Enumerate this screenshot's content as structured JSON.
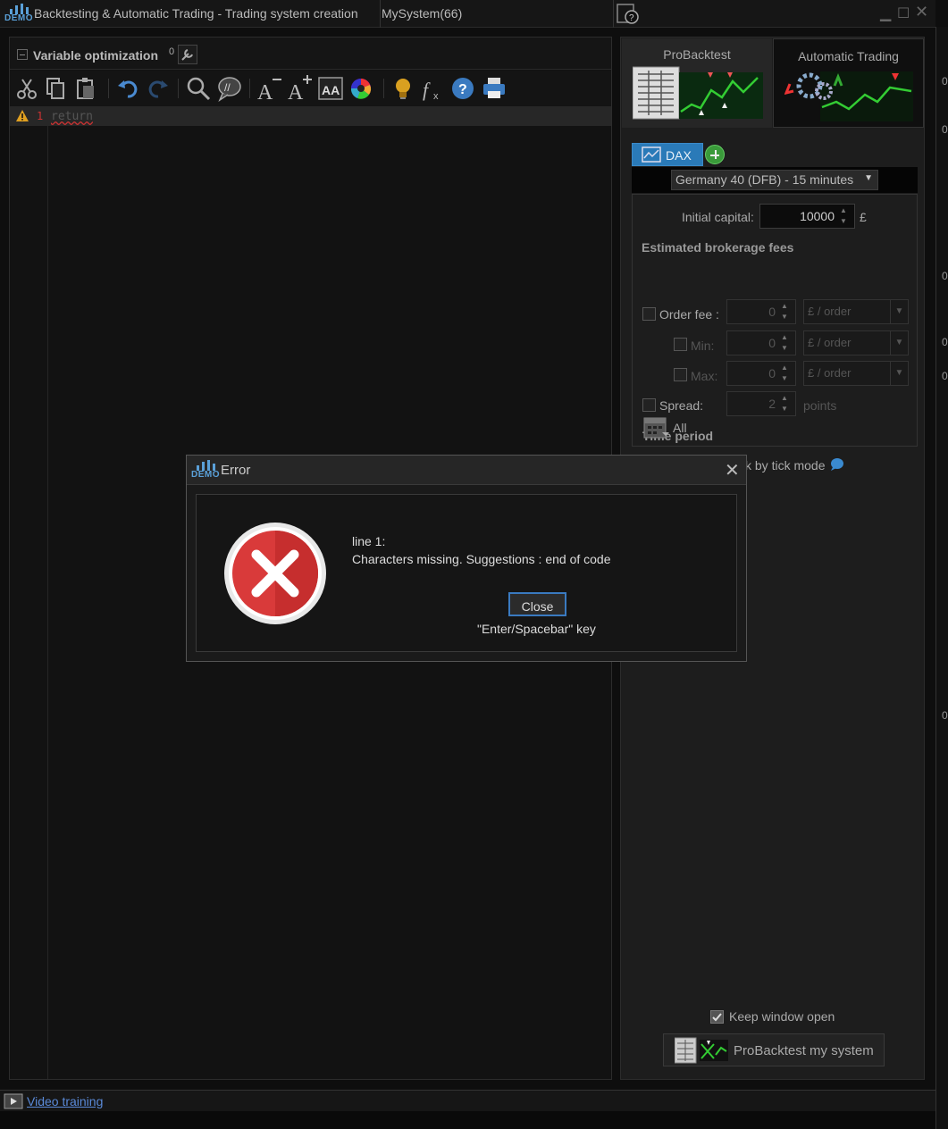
{
  "titlebar": {
    "badge": "DEMO",
    "title": "Backtesting & Automatic Trading - Trading system creation",
    "system_name": "MySystem(66)"
  },
  "editor": {
    "var_label": "Variable optimization",
    "var_count": "0",
    "line_number": "1",
    "code": "return"
  },
  "right": {
    "tabs": [
      "ProBacktest",
      "Automatic Trading"
    ],
    "instrument_tab": "DAX",
    "instrument": "Germany 40 (DFB) - 15 minutes",
    "initial_capital_label": "Initial capital:",
    "initial_capital": "10000",
    "currency": "£",
    "fees_heading": "Estimated brokerage fees",
    "order_fee_label": "Order fee :",
    "min_label": "Min:",
    "max_label": "Max:",
    "spread_label": "Spread:",
    "order_fee": "0",
    "min": "0",
    "max": "0",
    "spread": "2",
    "unit": "£ / order",
    "spread_unit": "points",
    "time_period_heading": "Time period",
    "time_period": "All",
    "tick_mode": "ck by tick mode",
    "keep_open": "Keep window open",
    "run_button": "ProBacktest my system"
  },
  "bottom": {
    "video_link": "Video training"
  },
  "dialog": {
    "badge": "DEMO",
    "title": "Error",
    "line": "line 1:",
    "message": "Characters missing. Suggestions : end of code",
    "close_button": "Close",
    "key_hint": "\"Enter/Spacebar\" key"
  },
  "colors": {
    "accent": "#2a7ab8",
    "error": "#d93a3a",
    "link": "#5a8ad8"
  }
}
